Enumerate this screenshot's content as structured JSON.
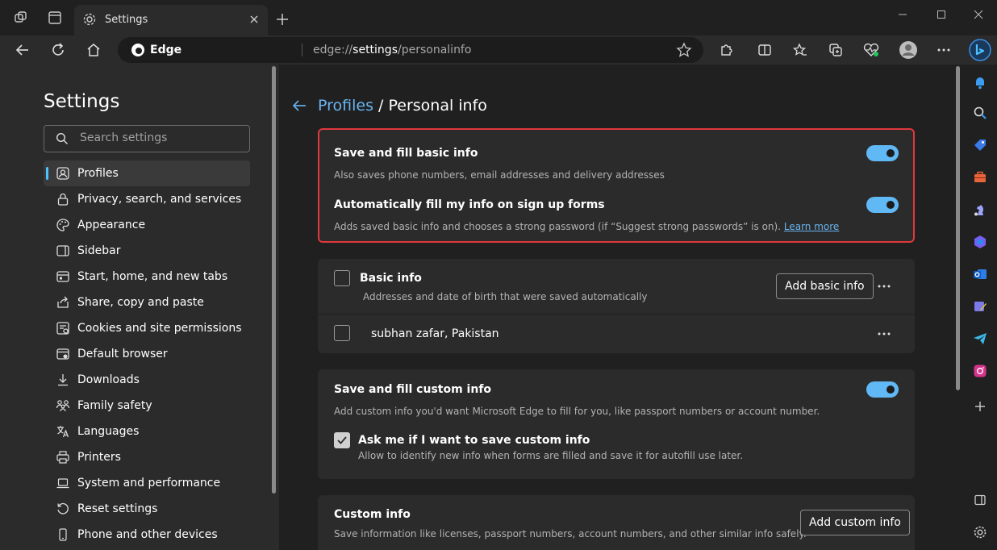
{
  "tab": {
    "title": "Settings"
  },
  "omnibox": {
    "site_label": "Edge",
    "url_prefix": "edge://",
    "url_highlight": "settings",
    "url_suffix": "/personalinfo"
  },
  "sidebar": {
    "title": "Settings",
    "search_placeholder": "Search settings",
    "items": [
      {
        "label": "Profiles",
        "icon": "profile-icon"
      },
      {
        "label": "Privacy, search, and services",
        "icon": "lock-icon"
      },
      {
        "label": "Appearance",
        "icon": "palette-icon"
      },
      {
        "label": "Sidebar",
        "icon": "sidebar-icon"
      },
      {
        "label": "Start, home, and new tabs",
        "icon": "home-tabs-icon"
      },
      {
        "label": "Share, copy and paste",
        "icon": "share-icon"
      },
      {
        "label": "Cookies and site permissions",
        "icon": "cookie-icon"
      },
      {
        "label": "Default browser",
        "icon": "browser-icon"
      },
      {
        "label": "Downloads",
        "icon": "download-icon"
      },
      {
        "label": "Family safety",
        "icon": "family-icon"
      },
      {
        "label": "Languages",
        "icon": "language-icon"
      },
      {
        "label": "Printers",
        "icon": "printer-icon"
      },
      {
        "label": "System and performance",
        "icon": "laptop-icon"
      },
      {
        "label": "Reset settings",
        "icon": "reset-icon"
      },
      {
        "label": "Phone and other devices",
        "icon": "phone-icon"
      }
    ]
  },
  "breadcrumb": {
    "parent": "Profiles",
    "separator": " / ",
    "current": "Personal info"
  },
  "basic_fill": {
    "title": "Save and fill basic info",
    "desc": "Also saves phone numbers, email addresses and delivery addresses",
    "enabled": true
  },
  "auto_fill": {
    "title": "Automatically fill my info on sign up forms",
    "desc": "Adds saved basic info and chooses a strong password (if “Suggest strong passwords” is on).",
    "learn_more": "Learn more",
    "enabled": true
  },
  "basic_info": {
    "title": "Basic info",
    "desc": "Addresses and date of birth that were saved automatically",
    "add_button": "Add basic info",
    "entry": "subhan zafar, Pakistan"
  },
  "custom_fill": {
    "title": "Save and fill custom info",
    "desc": "Add custom info you'd want Microsoft Edge to fill for you, like passport numbers or account number.",
    "enabled": true,
    "ask_title": "Ask me if I want to save custom info",
    "ask_desc": "Allow to identify new info when forms are filled and save it for autofill use later.",
    "ask_checked": true
  },
  "custom_info": {
    "title": "Custom info",
    "desc": "Save information like licenses, passport numbers, account numbers, and other similar info safely.",
    "add_button": "Add custom info"
  },
  "colors": {
    "accent": "#60b8f4",
    "link": "#6ab4f0",
    "highlight_border": "#e0383c"
  }
}
